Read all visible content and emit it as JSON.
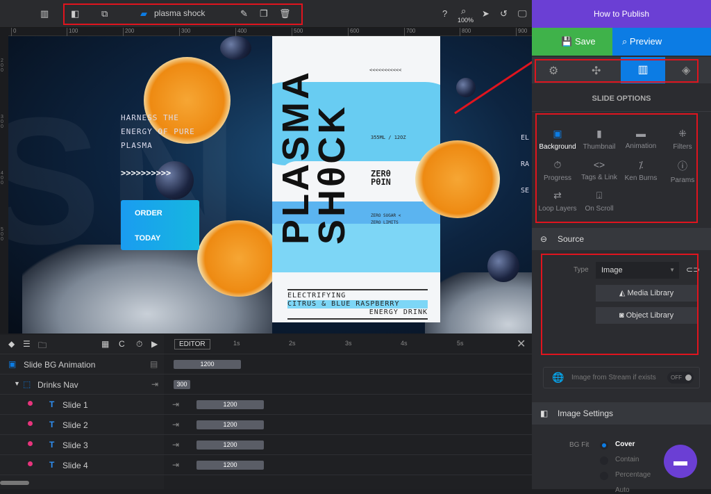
{
  "toolbar": {
    "slide_name": "plasma shock",
    "zoom": "100%"
  },
  "ruler": {
    "ticks": [
      "0",
      "100",
      "200",
      "300",
      "400",
      "500",
      "600",
      "700",
      "800",
      "900"
    ],
    "left_ticks": [
      "200",
      "300",
      "400",
      "500"
    ]
  },
  "canvas": {
    "headline": [
      "HARNESS THE",
      "ENERGY OF PURE",
      "PLASMA"
    ],
    "arrows": ">>>>>>>>>>",
    "cta": [
      "ORDER",
      "TODAY"
    ],
    "right_cut": [
      "EL",
      "RA",
      "SE"
    ],
    "can": {
      "brand": [
        "PLASMA",
        "SHθCK"
      ],
      "chevrons": "<<<<<<<<<<<",
      "volume": "355ML / 12OZ",
      "logo": [
        "ZERθ",
        "PθIN"
      ],
      "tag": [
        "ZERO SUGAR <",
        "ZERO LIMITS"
      ],
      "desc": [
        "ELECTRIFYING",
        "CITRUS &  BLUE RASPBERRY",
        "ENERGY DRINK"
      ]
    }
  },
  "timeline": {
    "editor_label": "EDITOR",
    "time_ticks": [
      "1s",
      "2s",
      "3s",
      "4s",
      "5s"
    ],
    "layers": [
      {
        "name": "Slide BG Animation",
        "duration": "1200"
      },
      {
        "name": "Drinks Nav",
        "duration": "300"
      },
      {
        "name": "Slide 1",
        "duration": "1200"
      },
      {
        "name": "Slide 2",
        "duration": "1200"
      },
      {
        "name": "Slide 3",
        "duration": "1200"
      },
      {
        "name": "Slide 4",
        "duration": "1200"
      }
    ]
  },
  "panel": {
    "how_to": "How to Publish",
    "save": "Save",
    "preview": "Preview",
    "section_title": "SLIDE OPTIONS",
    "options": [
      {
        "label": "Background",
        "icon": "image-icon",
        "active": true
      },
      {
        "label": "Thumbnail",
        "icon": "thumbnail-icon"
      },
      {
        "label": "Animation",
        "icon": "clapper-icon"
      },
      {
        "label": "Filters",
        "icon": "filters-icon"
      },
      {
        "label": "Progress",
        "icon": "stopwatch-icon"
      },
      {
        "label": "Tags & Link",
        "icon": "code-icon"
      },
      {
        "label": "Ken Burns",
        "icon": "ken-burns-icon"
      },
      {
        "label": "Params",
        "icon": "info-icon"
      },
      {
        "label": "Loop Layers",
        "icon": "loop-icon"
      },
      {
        "label": "On Scroll",
        "icon": "scroll-icon"
      }
    ],
    "source": "Source",
    "type_label": "Type",
    "type_value": "Image",
    "media_library": "Media Library",
    "object_library": "Object Library",
    "stream_label": "Image from Stream if exists",
    "stream_toggle": "OFF",
    "image_settings": "Image Settings",
    "bg_fit_label": "BG Fit",
    "bg_fit_options": [
      "Cover",
      "Contain",
      "Percentage",
      "Auto"
    ],
    "bg_fit_selected": "Cover"
  },
  "colors": {
    "accent": "#0c7ce4",
    "save": "#3fb24a",
    "header": "#6b3fd4",
    "annotation": "#e0141e"
  }
}
